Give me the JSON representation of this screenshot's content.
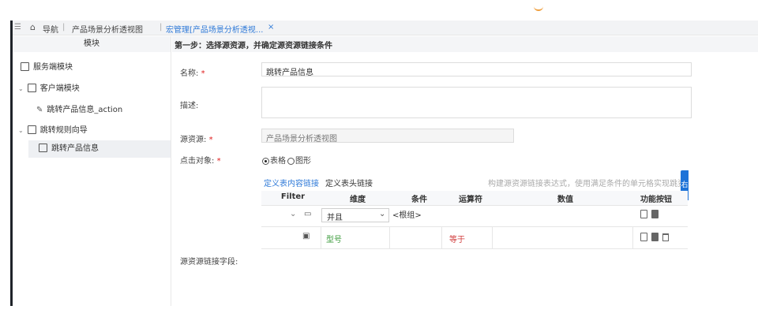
{
  "breadcrumb": {
    "menu_icon": "menu-icon",
    "home_icon": "home-icon",
    "nav": "导航",
    "page": "产品场景分析透视图",
    "tab": "宏管理[产品场景分析透视...",
    "tab_close": "×"
  },
  "sidebar": {
    "header": "模块",
    "items": [
      {
        "label": "服务端模块",
        "icon": "server-module-icon"
      },
      {
        "label": "客户端模块",
        "icon": "client-module-icon"
      },
      {
        "label": "跳转产品信息_action",
        "icon": "action-edit-icon"
      },
      {
        "label": "跳转规则向导",
        "icon": "wizard-icon"
      },
      {
        "label": "跳转产品信息",
        "icon": "jump-icon"
      }
    ]
  },
  "step_title": "第一步：选择源资源，并确定源资源链接条件",
  "form": {
    "name_label": "名称:",
    "name_value": "跳转产品信息",
    "desc_label": "描述:",
    "desc_value": "",
    "source_label": "源资源:",
    "source_value": "产品场景分析透视图",
    "target_label": "点击对象:",
    "radio_table": "表格",
    "radio_chart": "图形",
    "required_mark": "*",
    "link_field_label": "源资源链接字段:"
  },
  "tabs": {
    "content_link": "定义表内容链接",
    "header_link": "定义表头链接",
    "hint": "构建源资源链接表达式，使用满足条件的单元格实现跳资源之"
  },
  "side_button": "右",
  "table": {
    "headers": [
      "Filter",
      "维度",
      "条件",
      "运算符",
      "数值",
      "功能按钮"
    ],
    "row1": {
      "expand": "⌄",
      "dimension": "并且",
      "condition": "<根组>"
    },
    "row2": {
      "dimension": "型号",
      "operator": "等于",
      "value": ""
    }
  },
  "colors": {
    "accent": "#2f7ad8",
    "required": "#e02020",
    "green_text": "#3a9a3a",
    "red_text": "#d03a3a"
  }
}
